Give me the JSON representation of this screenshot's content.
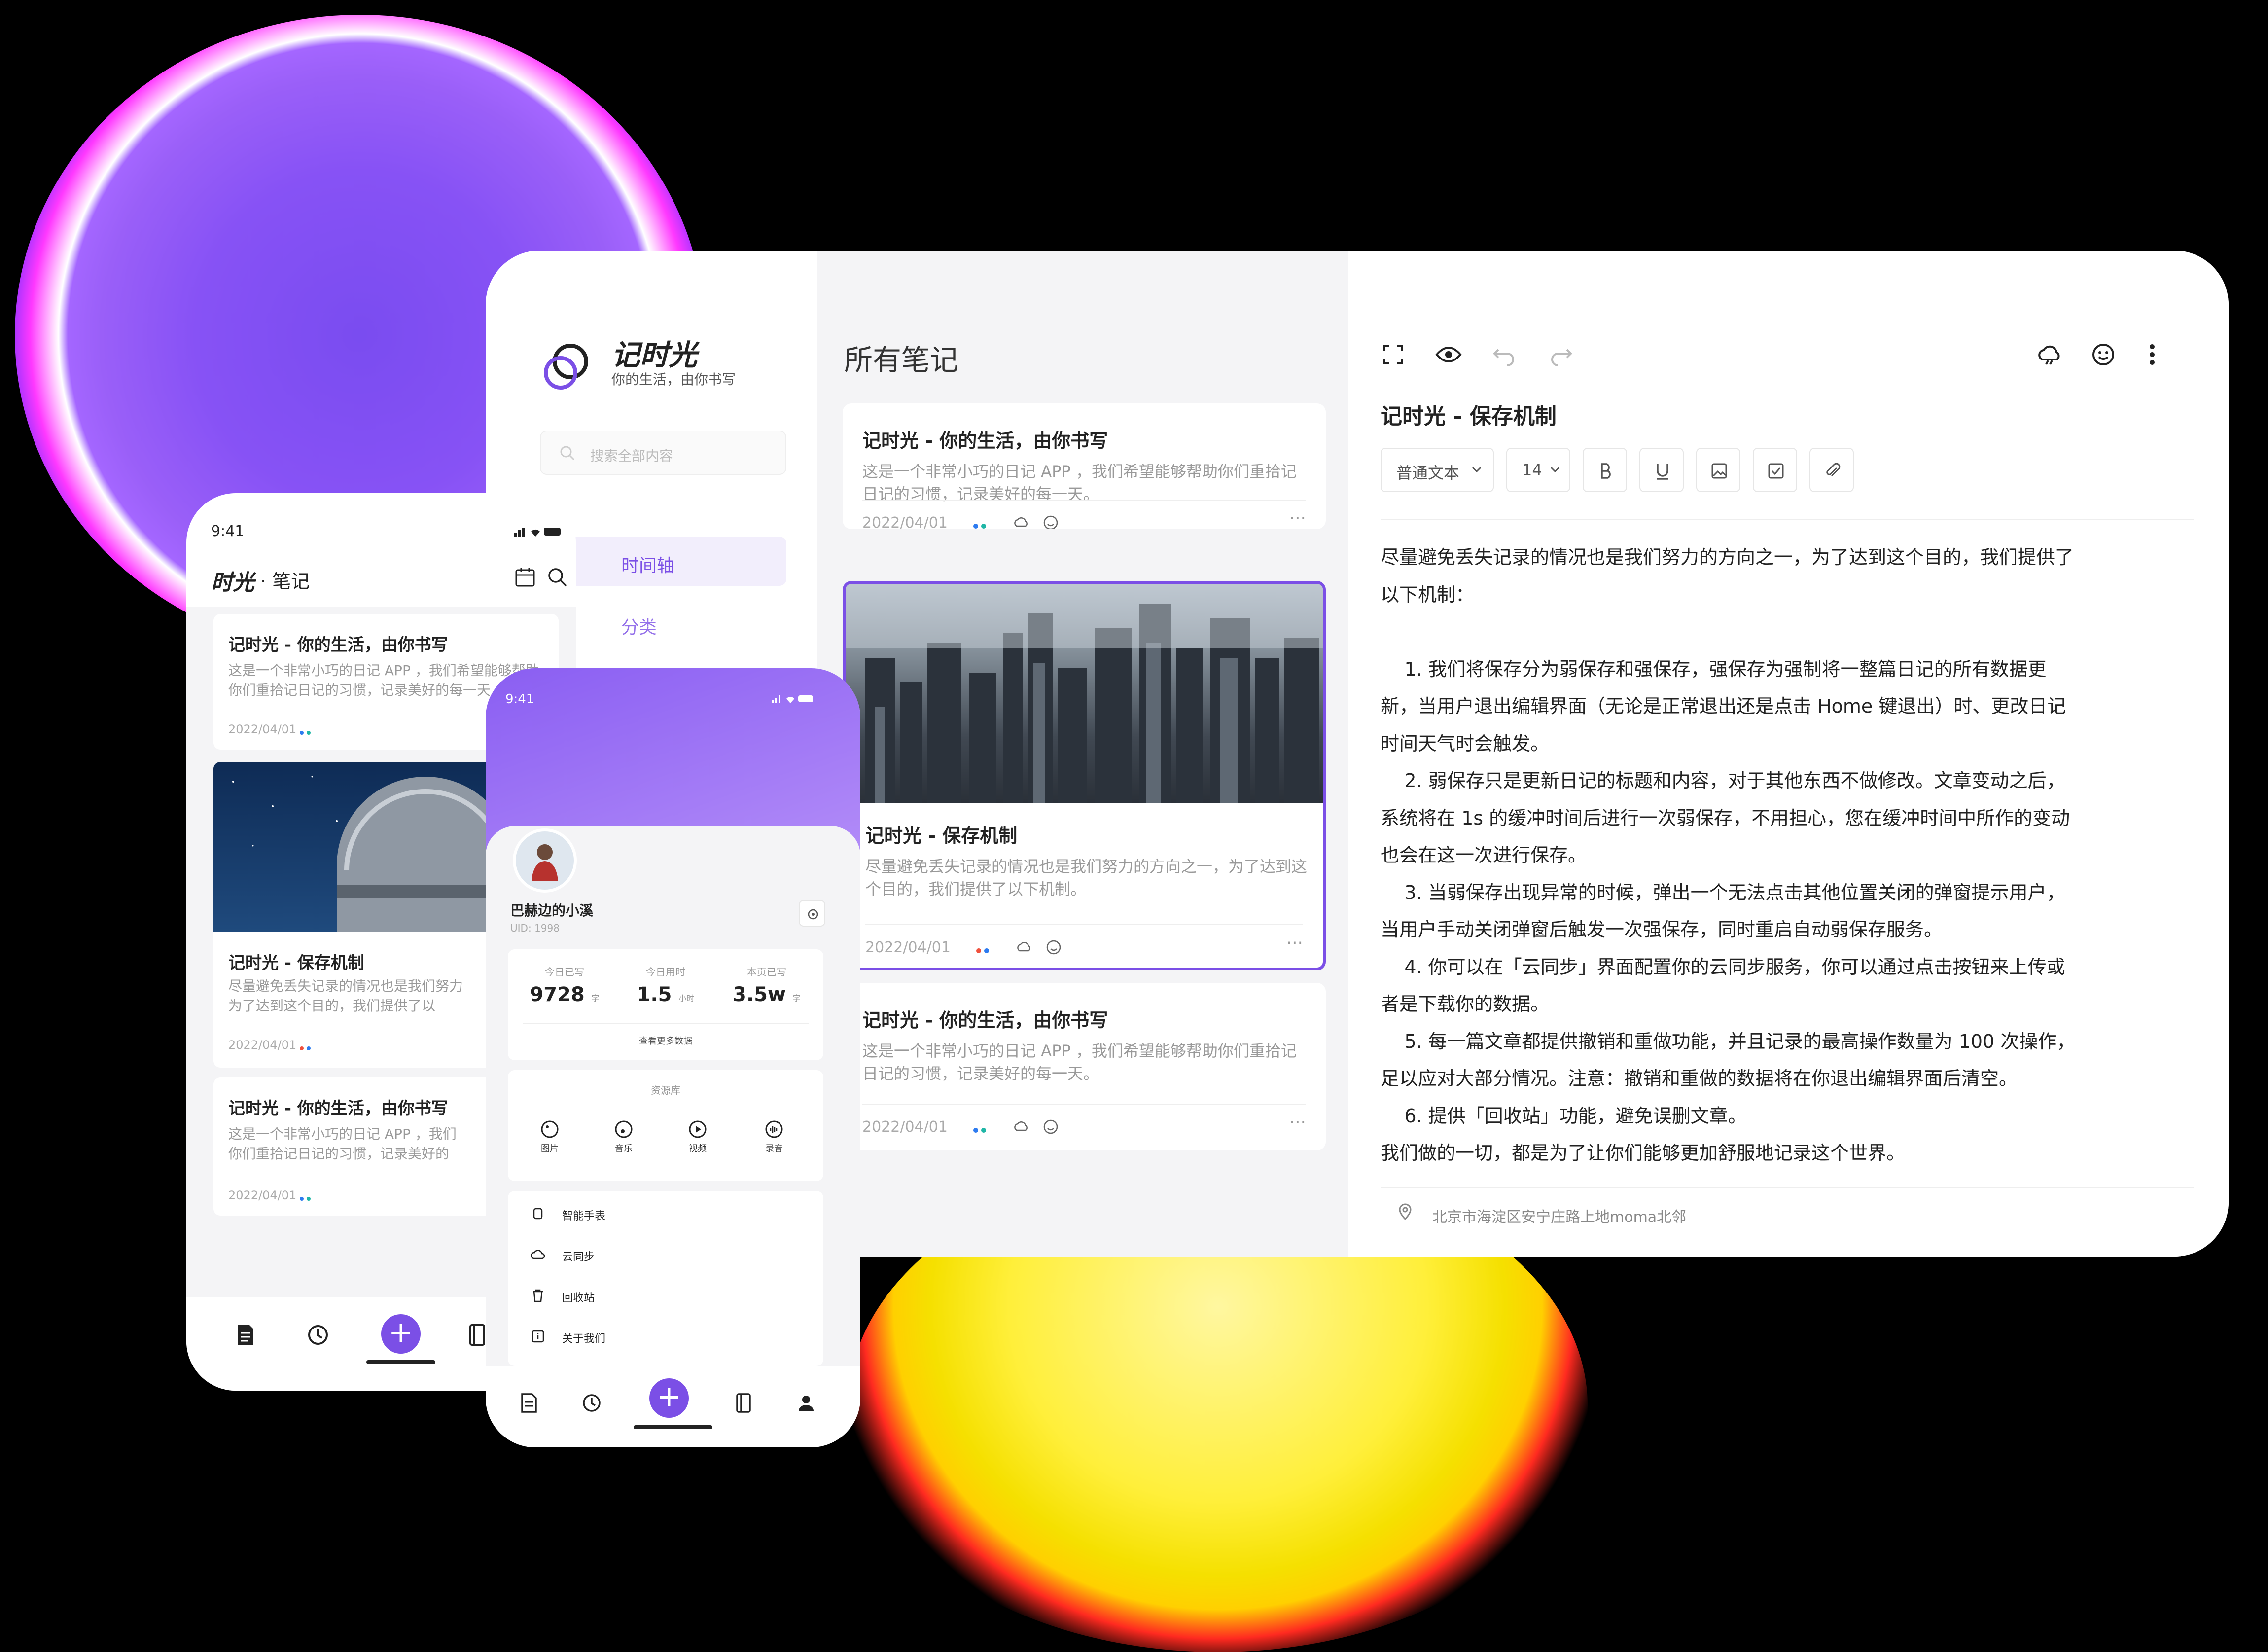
{
  "desktop": {
    "brand": {
      "name": "记时光",
      "tagline": "你的生活，由你书写"
    },
    "search_placeholder": "搜索全部内容",
    "nav": [
      {
        "label": "时间轴"
      },
      {
        "label": "分类"
      }
    ],
    "list_title": "所有笔记",
    "notes": [
      {
        "title": "记时光 - 你的生活，由你书写",
        "desc": "这是一个非常小巧的日记 APP ，我们希望能够帮助你们重拾记日记的习惯，记录美好的每一天。",
        "date": "2022/04/01"
      },
      {
        "title": "记时光 - 保存机制",
        "desc": "尽量避免丢失记录的情况也是我们努力的方向之一，为了达到这个目的，我们提供了以下机制。",
        "date": "2022/04/01"
      },
      {
        "title": "记时光 - 你的生活，由你书写",
        "desc": "这是一个非常小巧的日记 APP ，我们希望能够帮助你们重拾记日记的习惯，记录美好的每一天。",
        "date": "2022/04/01"
      }
    ],
    "more": "···",
    "editor": {
      "title": "记时光 - 保存机制",
      "format_select": "普通文本",
      "size_select": "14",
      "body": "尽量避免丢失记录的情况也是我们努力的方向之一，为了达到这个目的，我们提供了\n以下机制：\n\n    1. 我们将保存分为弱保存和强保存，强保存为强制将一整篇日记的所有数据更\n新，当用户退出编辑界面（无论是正常退出还是点击 Home 键退出）时、更改日记\n时间天气时会触发。\n    2. 弱保存只是更新日记的标题和内容，对于其他东西不做修改。文章变动之后，\n系统将在 1s 的缓冲时间后进行一次弱保存，不用担心，您在缓冲时间中所作的变动\n也会在这一次进行保存。\n    3. 当弱保存出现异常的时候，弹出一个无法点击其他位置关闭的弹窗提示用户，\n当用户手动关闭弹窗后触发一次强保存，同时重启自动弱保存服务。\n    4. 你可以在「云同步」界面配置你的云同步服务，你可以通过点击按钮来上传或\n者是下载你的数据。\n    5. 每一篇文章都提供撤销和重做功能，并且记录的最高操作数量为 100 次操作，\n足以应对大部分情况。注意：撤销和重做的数据将在你退出编辑界面后清空。\n    6. 提供「回收站」功能，避免误删文章。\n我们做的一切，都是为了让你们能够更加舒服地记录这个世界。",
      "location": "北京市海淀区安宁庄路上地moma北邻"
    }
  },
  "phone1": {
    "time": "9:41",
    "brand": "时光",
    "section": "· 笔记",
    "notes": [
      {
        "title": "记时光 - 你的生活，由你书写",
        "desc": "这是一个非常小巧的日记 APP ，我们希望能够帮助\n你们重拾记日记的习惯，记录美好的每一天",
        "date": "2022/04/01"
      },
      {
        "title": "记时光 - 保存机制",
        "desc": "尽量避免丢失记录的情况也是我们努力\n为了达到这个目的，我们提供了以",
        "date": "2022/04/01"
      },
      {
        "title": "记时光 - 你的生活，由你书写",
        "desc": "这是一个非常小巧的日记 APP ，我们\n你们重拾记日记的习惯，记录美好的",
        "date": "2022/04/01"
      }
    ]
  },
  "phone2": {
    "time": "9:41",
    "username": "巴赫边的小溪",
    "uid": "UID: 1998",
    "stats": [
      {
        "label": "今日已写",
        "value": "9728",
        "unit": "字"
      },
      {
        "label": "今日用时",
        "value": "1.5",
        "unit": "小时"
      },
      {
        "label": "本页已写",
        "value": "3.5w",
        "unit": "字"
      }
    ],
    "more_data": "查看更多数据",
    "library": "资源库",
    "resources": [
      "图片",
      "音乐",
      "视频",
      "录音"
    ],
    "menu": [
      "智能手表",
      "云同步",
      "回收站",
      "关于我们"
    ]
  },
  "colors": {
    "accent": "#7b4fe6",
    "dot_blue": "#2d7bf0",
    "dot_teal": "#1fb6a6",
    "dot_red": "#f0503c"
  }
}
